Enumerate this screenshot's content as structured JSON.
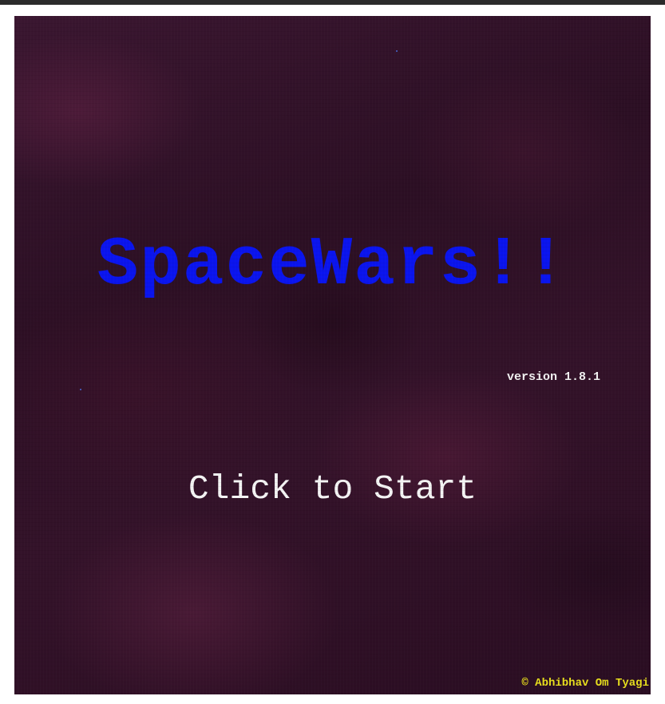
{
  "game": {
    "title": "SpaceWars!!",
    "version": "version 1.8.1",
    "start_prompt": "Click to Start",
    "credit": "© Abhibhav Om Tyagi"
  },
  "colors": {
    "title": "#0a14ee",
    "version": "#f2f2f2",
    "start_prompt": "#f4f4f4",
    "credit": "#e8df1c",
    "background": "#2c0f24"
  }
}
